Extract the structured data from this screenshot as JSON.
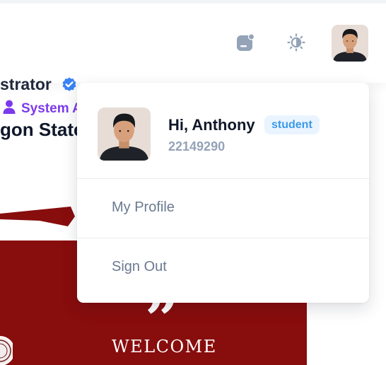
{
  "header": {
    "icons": [
      "notification-icon",
      "sun-icon",
      "avatar"
    ]
  },
  "background": {
    "role_title": "strator",
    "role_badge": "System A",
    "school_name": "gon State",
    "welcome": "WELCOME",
    "banner_color": "#880d0d"
  },
  "dropdown": {
    "greeting": "Hi, Anthony",
    "role": "student",
    "student_id": "22149290",
    "items": [
      {
        "label": "My Profile",
        "icon": "none"
      },
      {
        "label": "Sign Out",
        "icon": "none"
      }
    ]
  },
  "colors": {
    "accent_purple": "#7c3aed",
    "badge_text": "#3b9ae9",
    "badge_bg": "#eaf4ff",
    "verified_blue": "#3b82f6"
  }
}
